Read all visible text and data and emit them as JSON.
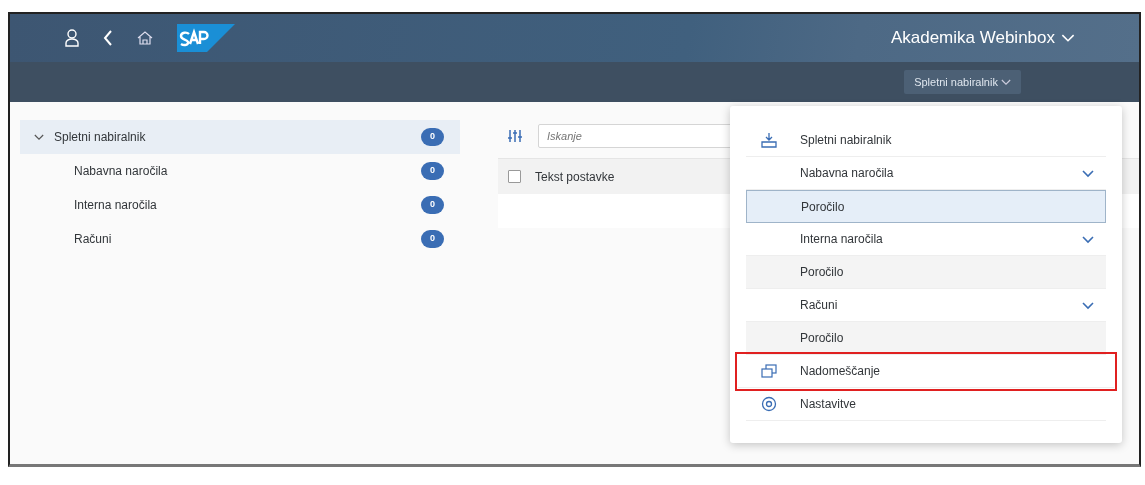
{
  "shell": {
    "title": "Akademika Webinbox",
    "subtitle": "Spletni nabiralnik"
  },
  "sidebar": {
    "items": [
      {
        "label": "Spletni nabiralnik",
        "count": "0",
        "selected": true,
        "expanded": true,
        "children": [
          {
            "label": "Nabavna naročila",
            "count": "0",
            "selected": false
          },
          {
            "label": "Interna naročila",
            "count": "0",
            "selected": false
          },
          {
            "label": "Računi",
            "count": "0",
            "selected": false
          }
        ]
      }
    ]
  },
  "search": {
    "placeholder": "Iskanje"
  },
  "table": {
    "select_all_checked": false,
    "columns": [
      "Tekst postavke"
    ]
  },
  "menu": {
    "items": [
      {
        "kind": "header",
        "label": "Spletni nabiralnik",
        "selected": false,
        "highlighted": false
      },
      {
        "kind": "group",
        "label": "Nabavna naročila",
        "selected": false,
        "highlighted": false
      },
      {
        "kind": "sub",
        "label": "Poročilo",
        "selected": true,
        "highlighted": false
      },
      {
        "kind": "group",
        "label": "Interna naročila",
        "selected": false,
        "highlighted": false
      },
      {
        "kind": "sub",
        "label": "Poročilo",
        "selected": false,
        "highlighted": false
      },
      {
        "kind": "group",
        "label": "Računi",
        "selected": false,
        "highlighted": false
      },
      {
        "kind": "sub",
        "label": "Poročilo",
        "selected": false,
        "highlighted": false
      },
      {
        "kind": "header",
        "label": "Nadomeščanje",
        "selected": false,
        "highlighted": true
      },
      {
        "kind": "header",
        "label": "Nastavitve",
        "selected": false,
        "highlighted": false
      }
    ]
  }
}
